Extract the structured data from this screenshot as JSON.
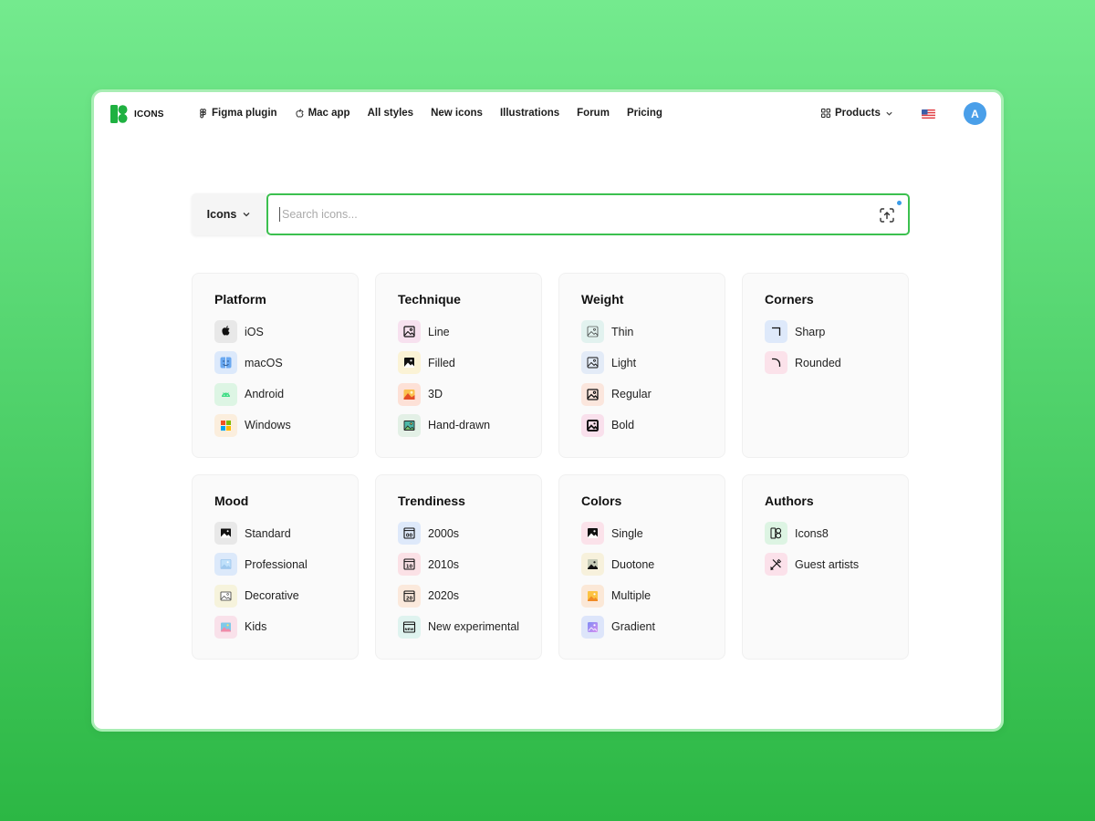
{
  "brand": {
    "name": "ICONS"
  },
  "nav": {
    "items": [
      {
        "label": "Figma plugin",
        "icon": "figma-icon"
      },
      {
        "label": "Mac app",
        "icon": "apple-icon"
      },
      {
        "label": "All styles"
      },
      {
        "label": "New icons"
      },
      {
        "label": "Illustrations"
      },
      {
        "label": "Forum"
      },
      {
        "label": "Pricing"
      }
    ],
    "products_label": "Products",
    "avatar_letter": "A"
  },
  "search": {
    "type_label": "Icons",
    "placeholder": "Search icons...",
    "value": ""
  },
  "filters": [
    {
      "title": "Platform",
      "options": [
        "iOS",
        "macOS",
        "Android",
        "Windows"
      ]
    },
    {
      "title": "Technique",
      "options": [
        "Line",
        "Filled",
        "3D",
        "Hand-drawn"
      ]
    },
    {
      "title": "Weight",
      "options": [
        "Thin",
        "Light",
        "Regular",
        "Bold"
      ]
    },
    {
      "title": "Corners",
      "options": [
        "Sharp",
        "Rounded"
      ]
    },
    {
      "title": "Mood",
      "options": [
        "Standard",
        "Professional",
        "Decorative",
        "Kids"
      ]
    },
    {
      "title": "Trendiness",
      "options": [
        "2000s",
        "2010s",
        "2020s",
        "New experimental"
      ]
    },
    {
      "title": "Colors",
      "options": [
        "Single",
        "Duotone",
        "Multiple",
        "Gradient"
      ]
    },
    {
      "title": "Authors",
      "options": [
        "Icons8",
        "Guest artists"
      ]
    }
  ],
  "colors": {
    "accent": "#3cc04f",
    "avatar": "#4a9fe9",
    "brand": "#1fb141"
  }
}
